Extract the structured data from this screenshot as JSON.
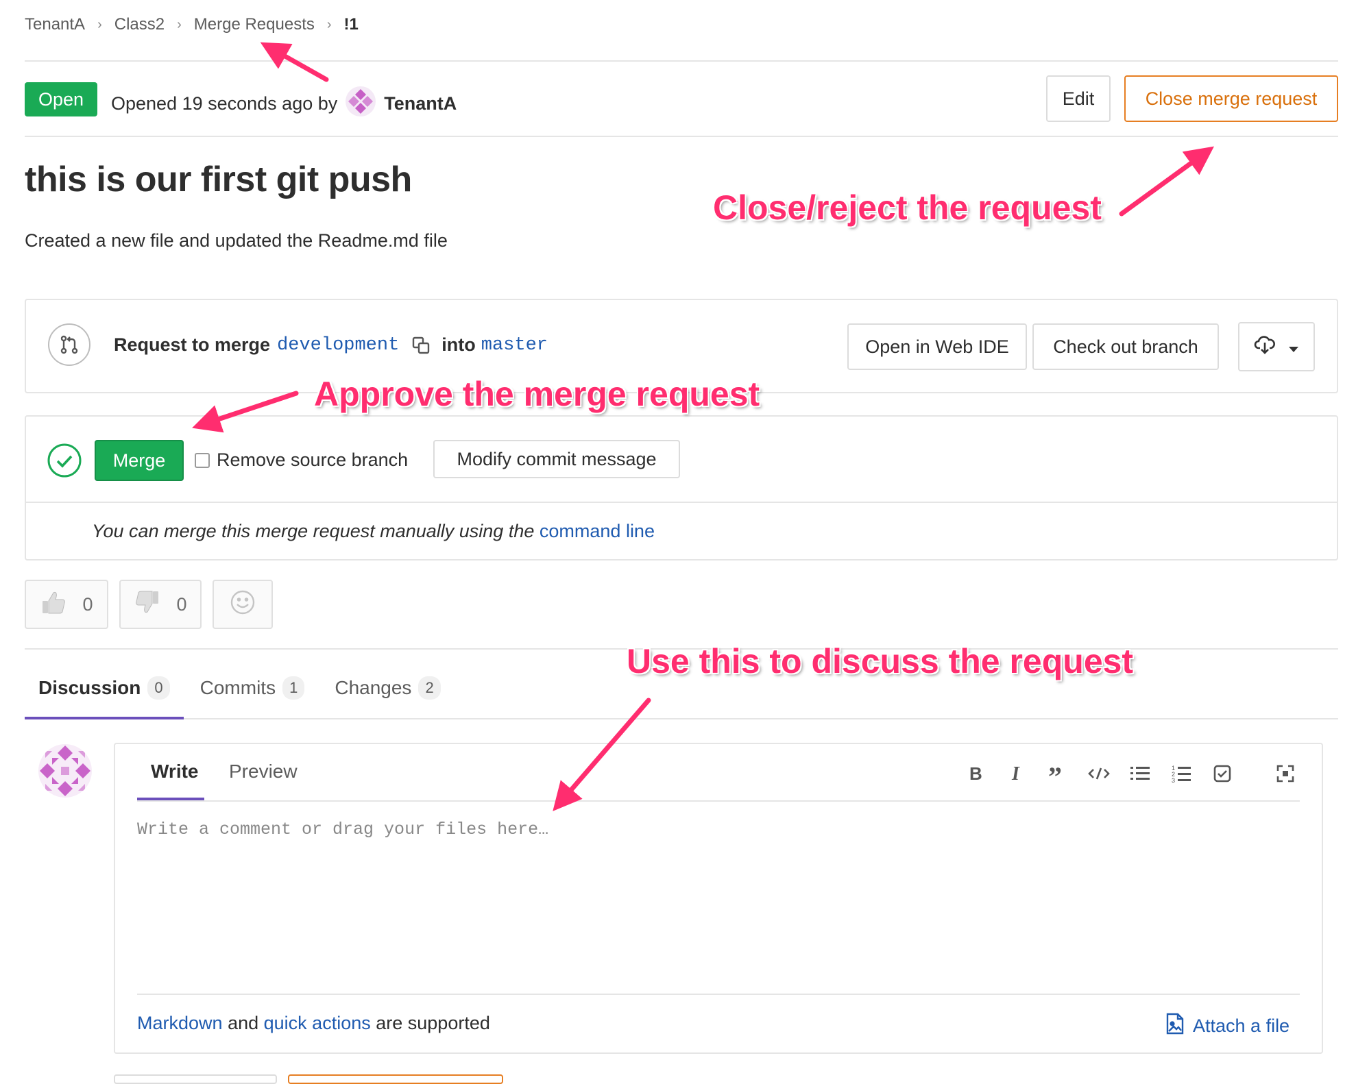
{
  "breadcrumb": {
    "items": [
      "TenantA",
      "Class2",
      "Merge Requests"
    ],
    "current": "!1"
  },
  "header": {
    "status": "Open",
    "opened_text": "Opened 19 seconds ago by",
    "author": "TenantA",
    "edit_label": "Edit",
    "close_label": "Close merge request"
  },
  "mr": {
    "title": "this is our first git push",
    "description": "Created a new file and updated the Readme.md file"
  },
  "merge_info": {
    "prefix": "Request to merge",
    "source_branch": "development",
    "into": "into",
    "target_branch": "master",
    "web_ide_label": "Open in Web IDE",
    "checkout_label": "Check out branch"
  },
  "merge_widget": {
    "merge_label": "Merge",
    "remove_source_label": "Remove source branch",
    "modify_commit_label": "Modify commit message",
    "manual_text": "You can merge this merge request manually using the",
    "command_line_link": "command line"
  },
  "awards": {
    "thumbs_up": "0",
    "thumbs_down": "0"
  },
  "tabs": [
    {
      "label": "Discussion",
      "count": "0"
    },
    {
      "label": "Commits",
      "count": "1"
    },
    {
      "label": "Changes",
      "count": "2"
    }
  ],
  "editor": {
    "write_tab": "Write",
    "preview_tab": "Preview",
    "placeholder": "Write a comment or drag your files here…",
    "markdown_link": "Markdown",
    "and_text": "and",
    "quick_actions_link": "quick actions",
    "supported_text": "are supported",
    "attach_label": "Attach a file"
  },
  "annotations": {
    "close": "Close/reject the request",
    "approve": "Approve the merge request",
    "discuss": "Use this to discuss the request"
  },
  "colors": {
    "open_green": "#1aaa55",
    "close_orange": "#e67e22",
    "link_blue": "#1f5bb0",
    "tab_underline": "#6b4fbb",
    "annotation_pink": "#ff2d6f"
  }
}
